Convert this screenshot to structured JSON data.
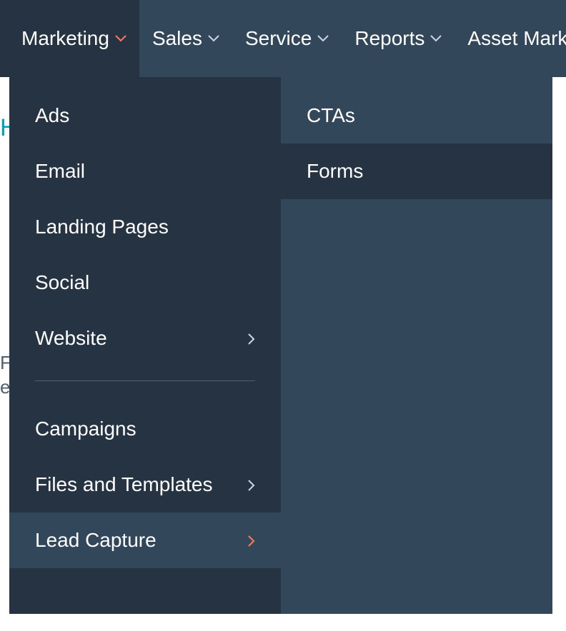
{
  "topnav": {
    "items": [
      {
        "label": "Marketing",
        "active": true
      },
      {
        "label": "Sales"
      },
      {
        "label": "Service"
      },
      {
        "label": "Reports"
      },
      {
        "label": "Asset Marketp"
      }
    ]
  },
  "dropdown": {
    "primary": [
      {
        "label": "Ads"
      },
      {
        "label": "Email"
      },
      {
        "label": "Landing Pages"
      },
      {
        "label": "Social"
      },
      {
        "label": "Website",
        "hasSubmenu": true
      }
    ],
    "secondary": [
      {
        "label": "Campaigns"
      },
      {
        "label": "Files and Templates",
        "hasSubmenu": true
      },
      {
        "label": "Lead Capture",
        "hasSubmenu": true,
        "active": true
      }
    ],
    "submenu": [
      {
        "label": "CTAs"
      },
      {
        "label": "Forms",
        "active": true
      }
    ]
  },
  "page": {
    "partial_heading": "H",
    "fragment_line1": "Fr",
    "fragment_line2": "et"
  },
  "colors": {
    "navDark": "#253342",
    "navMid": "#33475b",
    "accent": "#ff7a59",
    "teal": "#00a4bd"
  }
}
